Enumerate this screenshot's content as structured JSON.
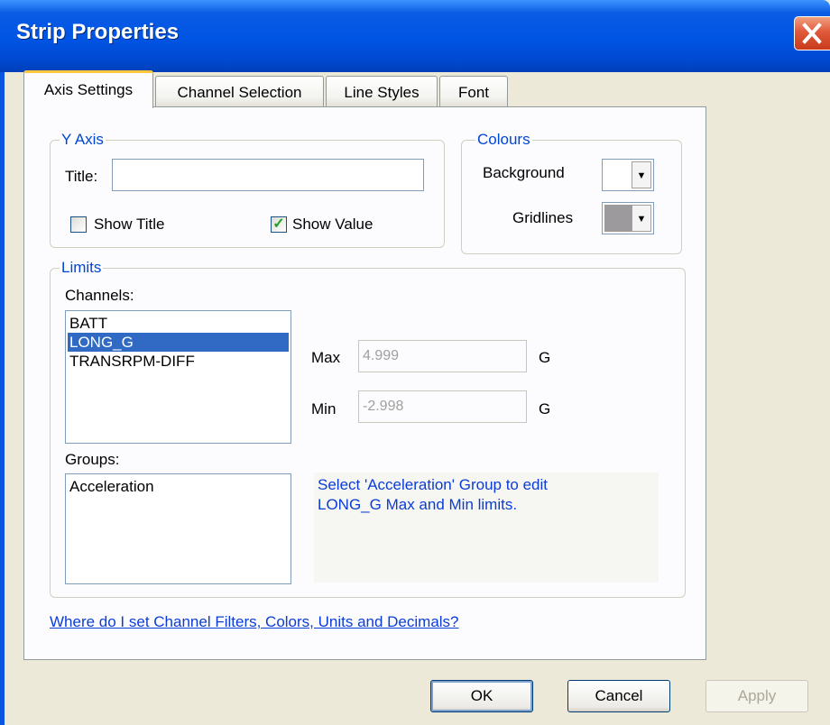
{
  "window": {
    "title": "Strip Properties"
  },
  "tabs": [
    {
      "label": "Axis Settings",
      "active": true
    },
    {
      "label": "Channel Selection",
      "active": false
    },
    {
      "label": "Line Styles",
      "active": false
    },
    {
      "label": "Font",
      "active": false
    }
  ],
  "y_axis": {
    "legend": "Y Axis",
    "title_label": "Title:",
    "title_value": "",
    "show_title_label": "Show Title",
    "show_title_checked": false,
    "show_value_label": "Show Value",
    "show_value_checked": true
  },
  "colours": {
    "legend": "Colours",
    "background_label": "Background",
    "background_color": "#ffffff",
    "gridlines_label": "Gridlines",
    "gridlines_color": "#9c9a9c"
  },
  "limits": {
    "legend": "Limits",
    "channels_label": "Channels:",
    "channels": [
      "BATT",
      "LONG_G",
      "TRANSRPM-DIFF"
    ],
    "selected_channel": "LONG_G",
    "max_label": "Max",
    "max_value": "4.999",
    "max_unit": "G",
    "min_label": "Min",
    "min_value": "-2.998",
    "min_unit": "G",
    "groups_label": "Groups:",
    "groups": [
      "Acceleration"
    ],
    "info_line1": "Select 'Acceleration' Group to edit",
    "info_line2": "LONG_G Max and Min limits."
  },
  "help_link": "Where do I set Channel Filters, Colors, Units and Decimals?",
  "buttons": {
    "ok": "OK",
    "cancel": "Cancel",
    "apply": "Apply"
  }
}
